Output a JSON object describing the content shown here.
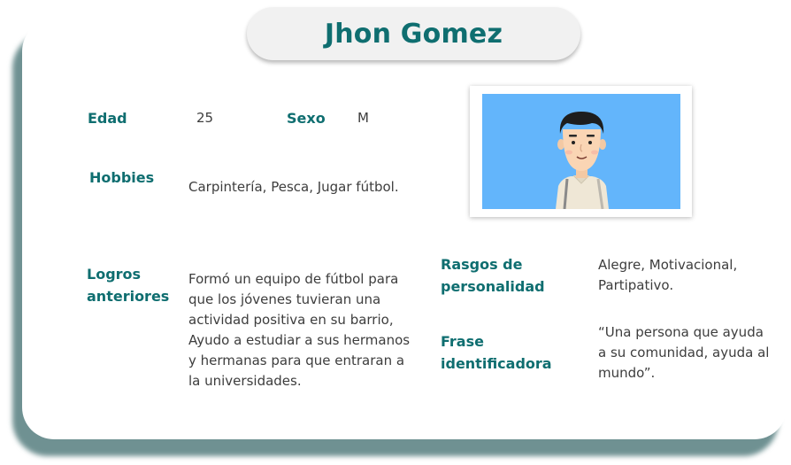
{
  "profile": {
    "name": "Jhon Gomez",
    "age_label": "Edad",
    "age_value": "25",
    "sex_label": "Sexo",
    "sex_value": "M",
    "hobbies_label": "Hobbies",
    "hobbies_value": "Carpintería, Pesca, Jugar fútbol.",
    "achievements_label_line1": "Logros",
    "achievements_label_line2": "anteriores",
    "achievements_value": "Formó un equipo de fútbol para que los jóvenes tuvieran una actividad positiva en su barrio, Ayudo a estudiar a sus hermanos y hermanas para que entraran a la universidades.",
    "traits_label_line1": "Rasgos de",
    "traits_label_line2": "personalidad",
    "traits_value": "Alegre, Motivacional, Partipativo.",
    "phrase_label_line1": "Frase",
    "phrase_label_line2": "identificadora",
    "phrase_value": "“Una persona que ayuda a su comunidad, ayuda al mundo”."
  },
  "colors": {
    "accent": "#0f6e70",
    "photo_background": "#63b5fb",
    "card_shadow": "#6f9192"
  },
  "icons": {
    "avatar": "person-avatar-illustration"
  }
}
